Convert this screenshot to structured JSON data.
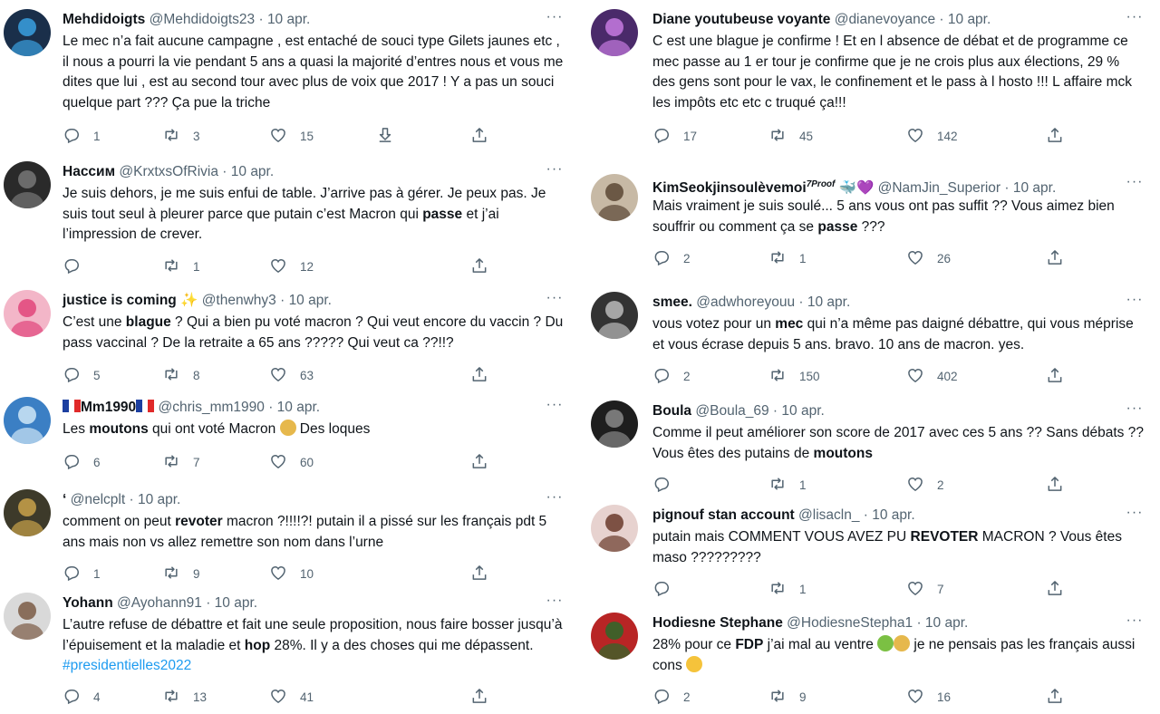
{
  "tweets_left": [
    {
      "name": "Mehdidoigts",
      "handle": "@Mehdidoigts23",
      "date": "10 apr.",
      "segments": [
        {
          "t": "Le mec n’a fait aucune campagne , est entaché de souci type Gilets jaunes etc , il nous a pourri la vie pendant 5 ans a quasi la majorité d’entres nous et vous me dites que lui , est au second tour avec plus de voix que 2017 ! Y a pas un souci quelque part ??? Ça pue la triche"
        }
      ],
      "replies": "1",
      "retweets": "3",
      "likes": "15",
      "has_download": true,
      "avatar_color": "#1a2f4a",
      "avatar_accent": "#3aa0e0"
    },
    {
      "name": "Нассим",
      "handle": "@KrxtxsOfRivia",
      "date": "10 apr.",
      "segments": [
        {
          "t": "Je suis dehors, je me suis enfui de table. J’arrive pas à gérer. Je peux pas. Je suis tout seul à pleurer parce que putain c’est Macron qui "
        },
        {
          "t": "passe",
          "b": true
        },
        {
          "t": " et j’ai l’impression de crever."
        }
      ],
      "replies": "",
      "retweets": "1",
      "likes": "12",
      "avatar_color": "#2a2a2a",
      "avatar_accent": "#777777"
    },
    {
      "name": "justice is coming ✨",
      "handle": "@thenwhy3",
      "date": "10 apr.",
      "segments": [
        {
          "t": "C’est une "
        },
        {
          "t": "blague",
          "b": true
        },
        {
          "t": " ? Qui a bien pu voté macron ? Qui veut encore du vaccin ? Du pass vaccinal ? De la retraite a 65 ans ????? Qui veut ca ??!!?"
        }
      ],
      "replies": "5",
      "retweets": "8",
      "likes": "63",
      "avatar_color": "#f3b6c8",
      "avatar_accent": "#e0457a"
    },
    {
      "name": "Mm1990",
      "handle": "@chris_mm1990",
      "date": "10 apr.",
      "flags": true,
      "segments": [
        {
          "t": "Les "
        },
        {
          "t": "moutons",
          "b": true
        },
        {
          "t": " qui ont voté Macron "
        },
        {
          "emoji": "em-sick"
        },
        {
          "t": " Des loques"
        }
      ],
      "replies": "6",
      "retweets": "7",
      "likes": "60",
      "avatar_color": "#3b7fc4",
      "avatar_accent": "#cfe6f7"
    },
    {
      "name": "‘",
      "handle": "@nelcplt",
      "date": "10 apr.",
      "segments": [
        {
          "t": "comment on peut "
        },
        {
          "t": "revoter",
          "b": true
        },
        {
          "t": " macron ?!!!!?! putain il a pissé sur les français pdt 5 ans mais non vs allez remettre son nom dans l’urne"
        }
      ],
      "replies": "1",
      "retweets": "9",
      "likes": "10",
      "avatar_color": "#3d3a2a",
      "avatar_accent": "#c9a24a"
    },
    {
      "name": "Yohann",
      "handle": "@Ayohann91",
      "date": "10 apr.",
      "segments": [
        {
          "t": "L’autre refuse de débattre et fait une seule proposition, nous faire bosser jusqu’à l’épuisement et la maladie et "
        },
        {
          "t": "hop",
          "b": true
        },
        {
          "t": " 28%. Il y a des choses qui me dépassent. "
        },
        {
          "t": "#presidentielles2022",
          "h": true
        }
      ],
      "replies": "4",
      "retweets": "13",
      "likes": "41",
      "avatar_color": "#d9d9d9",
      "avatar_accent": "#7a5a44"
    }
  ],
  "tweets_right": [
    {
      "name": "Diane youtubeuse voyante",
      "handle": "@dianevoyance",
      "date": "10 apr.",
      "segments": [
        {
          "t": "C est une blague je confirme ! Et en l absence de débat et de programme ce mec passe au 1 er tour je confirme que je ne crois plus aux élections, 29 % des gens sont pour le vax, le confinement et le pass à l hosto !!! L affaire mck les impôts etc etc c truqué ça!!!"
        }
      ],
      "replies": "17",
      "retweets": "45",
      "likes": "142",
      "avatar_color": "#4a2a6a",
      "avatar_accent": "#c57ae0"
    },
    {
      "name": "KimSeokjinsoulèvemoi",
      "name_sup": "7Proof",
      "name_extra": "🐳💜",
      "handle": "@NamJin_Superior",
      "date": "10 apr.",
      "segments": [
        {
          "t": "Mais vraiment je suis soulé... 5 ans vous ont pas suffit ?? Vous aimez bien souffrir ou comment ça se "
        },
        {
          "t": "passe",
          "b": true
        },
        {
          "t": " ???"
        }
      ],
      "replies": "2",
      "retweets": "1",
      "likes": "26",
      "avatar_color": "#c7b9a5",
      "avatar_accent": "#5a4634"
    },
    {
      "name": "smee.",
      "handle": "@adwhoreyouu",
      "date": "10 apr.",
      "segments": [
        {
          "t": "vous votez pour un "
        },
        {
          "t": "mec",
          "b": true
        },
        {
          "t": " qui n’a même pas daigné débattre, qui vous méprise et vous écrase depuis 5 ans. bravo. 10 ans de macron. yes."
        }
      ],
      "replies": "2",
      "retweets": "150",
      "likes": "402",
      "avatar_color": "#333333",
      "avatar_accent": "#bbbbbb"
    },
    {
      "name": "Boula",
      "handle": "@Boula_69",
      "date": "10 apr.",
      "segments": [
        {
          "t": "Comme il peut améliorer son score de 2017 avec ces 5 ans ?? Sans débats ?? Vous êtes des putains de "
        },
        {
          "t": "moutons",
          "b": true
        }
      ],
      "replies": "",
      "retweets": "1",
      "likes": "2",
      "avatar_color": "#1e1e1e",
      "avatar_accent": "#888888"
    },
    {
      "name": "pignouf stan account",
      "handle": "@lisacln_",
      "date": "10 apr.",
      "segments": [
        {
          "t": "putain mais COMMENT VOUS AVEZ PU "
        },
        {
          "t": "REVOTER",
          "b": true
        },
        {
          "t": " MACRON ? Vous êtes maso ?????????"
        }
      ],
      "replies": "",
      "retweets": "1",
      "likes": "7",
      "avatar_color": "#e7d2cf",
      "avatar_accent": "#6a3b2b"
    },
    {
      "name": "Hodiesne Stephane",
      "handle": "@HodiesneStepha1",
      "date": "10 apr.",
      "segments": [
        {
          "t": "28% pour ce "
        },
        {
          "t": "FDP",
          "b": true
        },
        {
          "t": " j’ai mal au ventre "
        },
        {
          "emoji": "em-green"
        },
        {
          "emoji": "em-sick"
        },
        {
          "t": " je ne pensais pas les français aussi cons "
        },
        {
          "emoji": "em-cry"
        }
      ],
      "replies": "2",
      "retweets": "9",
      "likes": "16",
      "avatar_color": "#b82525",
      "avatar_accent": "#2a6a2a"
    }
  ]
}
